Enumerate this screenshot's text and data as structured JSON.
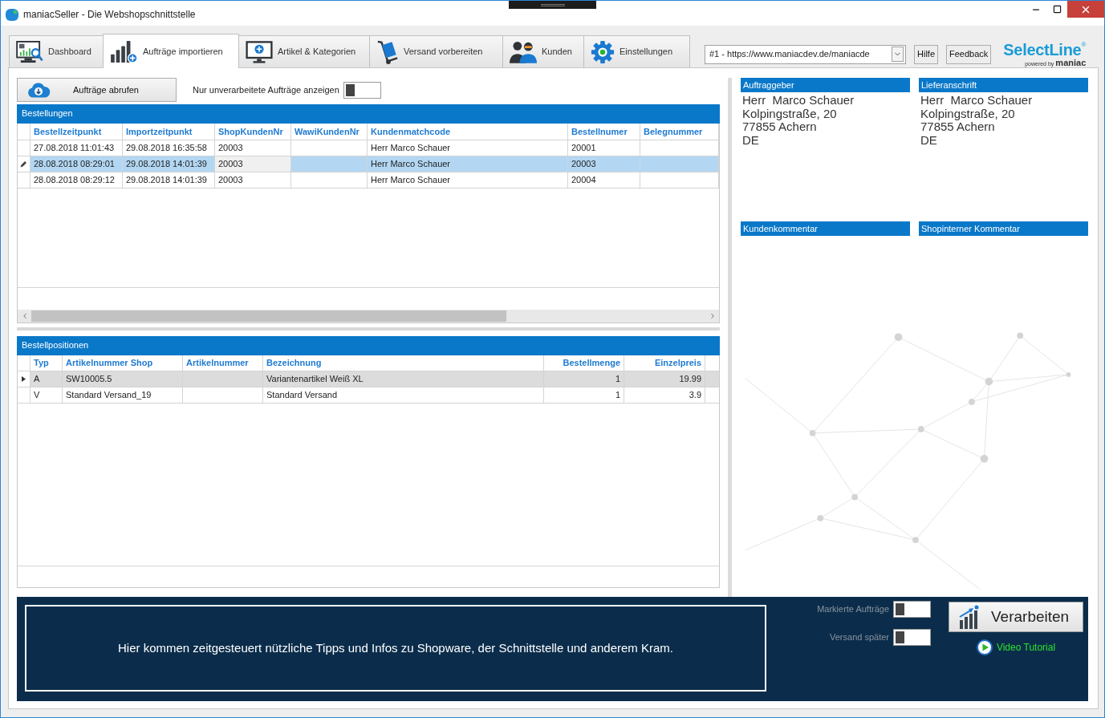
{
  "window": {
    "title": "maniacSeller - Die Webshopschnittstelle"
  },
  "tabs": [
    {
      "label": "Dashboard",
      "selected": false
    },
    {
      "label": "Aufträge importieren",
      "selected": true
    },
    {
      "label": "Artikel & Kategorien",
      "selected": false
    },
    {
      "label": "Versand vorbereiten",
      "selected": false
    },
    {
      "label": "Kunden",
      "selected": false
    },
    {
      "label": "Einstellungen",
      "selected": false
    }
  ],
  "shop_selector": {
    "value": "#1 - https://www.maniacdev.de/maniacde"
  },
  "header_buttons": [
    "Hilfe",
    "Feedback"
  ],
  "logo": {
    "name": "SelectLine",
    "mark": "®",
    "tagline": "powered by",
    "brand": "maniac"
  },
  "toolbar": {
    "fetch_button": "Aufträge abrufen",
    "filter": {
      "label": "Nur unverarbeitete Aufträge anzeigen",
      "on": false
    }
  },
  "orders": {
    "title": "Bestellungen",
    "focused": true,
    "columns": [
      "Bestellzeitpunkt",
      "Importzeitpunkt",
      "ShopKundenNr",
      "WawiKundenNr",
      "Kundenmatchcode",
      "Bestellnumer",
      "Belegnummer"
    ],
    "rows": [
      {
        "editing": false,
        "selected": false,
        "cells": [
          {
            "text": "27.08.2018 11:01:43",
            "focused": false
          },
          {
            "text": "29.08.2018 16:35:58",
            "focused": false
          },
          {
            "text": "20003",
            "focused": false
          },
          {
            "focused": false
          },
          {
            "text": "Herr Marco Schauer",
            "focused": false
          },
          {
            "text": "20001",
            "focused": false
          },
          {
            "focused": false
          }
        ]
      },
      {
        "editing": true,
        "selected": true,
        "cells": [
          {
            "text": "28.08.2018 08:29:01",
            "focused": false
          },
          {
            "text": "29.08.2018 14:01:39",
            "focused": false
          },
          {
            "text": "20003",
            "focused": true
          },
          {
            "focused": false
          },
          {
            "text": "Herr Marco Schauer",
            "focused": false
          },
          {
            "text": "20003",
            "focused": false
          },
          {
            "focused": false
          }
        ]
      },
      {
        "editing": false,
        "selected": false,
        "cells": [
          {
            "text": "28.08.2018 08:29:12",
            "focused": false
          },
          {
            "text": "29.08.2018 14:01:39",
            "focused": false
          },
          {
            "text": "20003",
            "focused": false
          },
          {
            "focused": false
          },
          {
            "text": "Herr Marco Schauer",
            "focused": false
          },
          {
            "text": "20004",
            "focused": false
          },
          {
            "focused": false
          }
        ]
      }
    ]
  },
  "positions": {
    "title": "Bestellpositionen",
    "focused": false,
    "columns": [
      "Typ",
      "Artikelnummer Shop",
      "Artikelnummer",
      "Bezeichnung",
      "Bestellmenge",
      "Einzelpreis"
    ],
    "rows": [
      {
        "current": true,
        "selected": true,
        "cells": [
          {
            "text": "A"
          },
          {
            "text": "SW10005.5"
          },
          {},
          {
            "text": "Variantenartikel Weiß XL"
          },
          {
            "text": "1"
          },
          {
            "text": "19.99"
          }
        ]
      },
      {
        "current": false,
        "selected": false,
        "cells": [
          {
            "text": "V"
          },
          {
            "text": "Standard Versand_19"
          },
          {},
          {
            "text": "Standard Versand"
          },
          {
            "text": "1"
          },
          {
            "text": "3.9"
          }
        ]
      }
    ]
  },
  "address_panels": [
    {
      "title": "Auftraggeber",
      "lines": [
        "Herr  Marco Schauer",
        "Kolpingstraße, 20",
        "77855 Achern",
        "DE"
      ]
    },
    {
      "title": "Lieferanschrift",
      "lines": [
        "Herr  Marco Schauer",
        "Kolpingstraße, 20",
        "77855 Achern",
        "DE"
      ]
    }
  ],
  "comment_panels": [
    {
      "title": "Kundenkommentar"
    },
    {
      "title": "Shopinterner Kommentar"
    }
  ],
  "footer": {
    "tip": "Hier kommen zeitgesteuert nützliche Tipps und Infos zu Shopware, der Schnittstelle und anderem Kram.",
    "options": [
      {
        "label": "Markierte Aufträge",
        "on": false
      },
      {
        "label": "Versand später",
        "on": false
      }
    ],
    "process_button": "Verarbeiten",
    "video_link": "Video Tutorial"
  }
}
